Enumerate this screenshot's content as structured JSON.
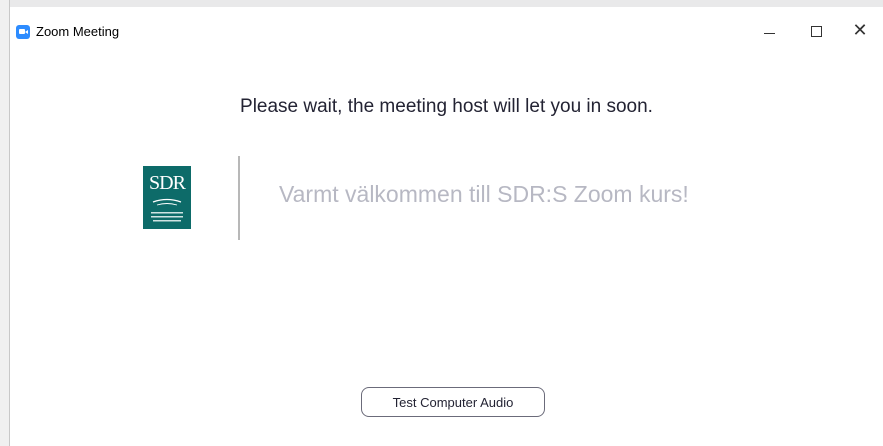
{
  "window": {
    "title": "Zoom Meeting",
    "icon": "zoom-camera-icon",
    "controls": {
      "minimize": "minimize-icon",
      "maximize": "maximize-icon",
      "close": "close-icon"
    }
  },
  "waiting_room": {
    "message": "Please wait, the meeting host will let you in soon.",
    "welcome_text": "Varmt välkommen till SDR:S Zoom kurs!",
    "logo": {
      "letters": "SDR",
      "icon": "sdr-logo-icon"
    },
    "test_audio_label": "Test Computer Audio"
  },
  "colors": {
    "zoom_blue": "#2d8cff",
    "logo_teal": "#0d6b69",
    "welcome_gray": "#b7b8c3",
    "text_dark": "#232333"
  }
}
